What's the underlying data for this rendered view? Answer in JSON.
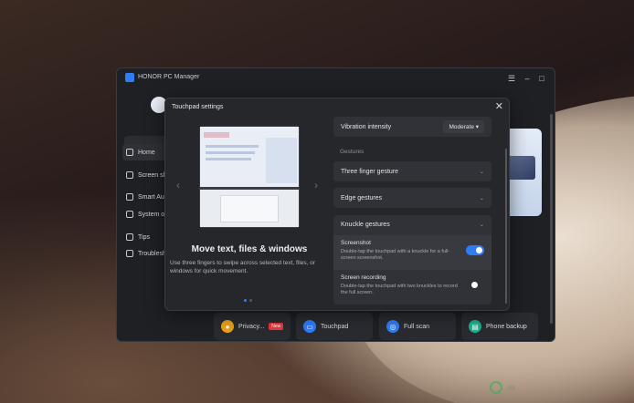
{
  "window": {
    "title": "HONOR PC Manager",
    "controls": [
      "☰",
      "–",
      "□",
      "✕"
    ]
  },
  "sidebar": {
    "items": [
      {
        "label": "Home",
        "active": true
      },
      {
        "label": "Screen sha",
        "active": false
      },
      {
        "label": "Smart Aud",
        "active": false
      },
      {
        "label": "System op",
        "active": false
      },
      {
        "label": "Tips",
        "active": false
      },
      {
        "label": "Troublesh",
        "active": false
      }
    ]
  },
  "bottom_actions": [
    {
      "label": "Privacy...",
      "badge": "New",
      "icon": "privacy-icon",
      "color": "#e8a21a"
    },
    {
      "label": "Touchpad",
      "icon": "touchpad-icon",
      "color": "#2f7cf6"
    },
    {
      "label": "Full scan",
      "icon": "scan-icon",
      "color": "#2f7cf6"
    },
    {
      "label": "Phone backup",
      "icon": "backup-icon",
      "color": "#1fae8c"
    }
  ],
  "dialog": {
    "title": "Touchpad settings",
    "close": "✕",
    "illustration": {
      "heading": "Move text, files & windows",
      "description": "Use three fingers to swipe across selected text, files, or windows for quick movement.",
      "prev": "‹",
      "next": "›",
      "page_index": 0,
      "page_count": 2
    },
    "vibration": {
      "label": "Vibration intensity",
      "value": "Moderate ▾"
    },
    "section_label": "Gestures",
    "gestures": [
      {
        "label": "Three finger gesture"
      },
      {
        "label": "Edge gestures"
      }
    ],
    "knuckle": {
      "label": "Knuckle gestures",
      "items": [
        {
          "title": "Screenshot",
          "desc": "Double-tap the touchpad with a knuckle for a full-screen screenshot.",
          "enabled": true
        },
        {
          "title": "Screen recording",
          "desc": "Double-tap the touchpad with two knuckles to record the full screen.",
          "enabled": false
        }
      ]
    }
  },
  "watermark": ".hk"
}
